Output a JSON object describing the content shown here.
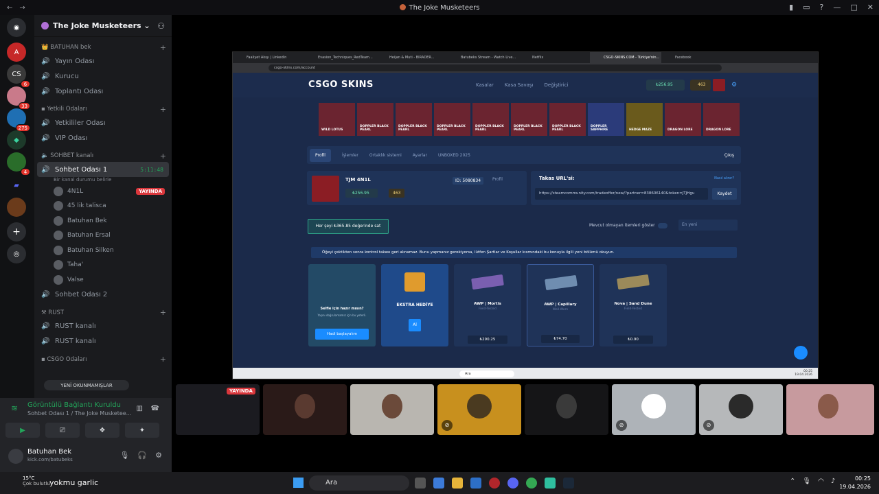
{
  "window": {
    "title": "The Joke Musketeers"
  },
  "servers": [
    {
      "name": "discord-home",
      "badge": ""
    },
    {
      "name": "server-a",
      "badge": ""
    },
    {
      "name": "server-csgo",
      "badge": "6"
    },
    {
      "name": "server-pink",
      "badge": "33"
    },
    {
      "name": "server-blue",
      "badge": "275"
    },
    {
      "name": "server-green",
      "badge": ""
    },
    {
      "name": "server-sprite",
      "badge": "4"
    },
    {
      "name": "server-folder",
      "badge": ""
    },
    {
      "name": "server-current",
      "badge": ""
    }
  ],
  "guild": {
    "name": "The Joke Musketeers"
  },
  "categories": {
    "c1": "BATUHAN bek",
    "c2": "Yetkili Odaları",
    "c3": "SOHBET kanalı",
    "c4": "RUST",
    "c5": "CSGO Odaları"
  },
  "channels": {
    "yayin": "Yayın Odası",
    "kurucu": "Kurucu",
    "toplanti": "Toplantı Odası",
    "yetkililer": "Yetkililer Odası",
    "vip": "VIP Odası",
    "sohbet1": "Sohbet Odası 1",
    "sohbet1_time": "5:11:48",
    "sohbet1_sub": "Bir kanal durumu belirle",
    "sohbet2": "Sohbet Odası 2",
    "rust1": "RUST kanalı",
    "rust2": "RUST kanalı"
  },
  "voice_users": [
    {
      "name": "4N1L",
      "live": "YAYINDA"
    },
    {
      "name": "45 lik talisca",
      "live": ""
    },
    {
      "name": "Batuhan Bek",
      "live": ""
    },
    {
      "name": "Batuhan Ersal",
      "live": ""
    },
    {
      "name": "Batuhan Silken",
      "live": ""
    },
    {
      "name": "Taha'",
      "live": ""
    },
    {
      "name": "Valse",
      "live": ""
    }
  ],
  "unread_pill": "YENİ OKUNMAMIŞLAR",
  "voice_panel": {
    "title": "Görüntülü Bağlantı Kuruldu",
    "subtitle": "Sohbet Odası 1 / The Joke Musketee..."
  },
  "user_panel": {
    "name": "Batuhan Bek",
    "status": "kick.com/batubeks"
  },
  "browser": {
    "tabs": [
      {
        "label": "Faaliyet Akışı | LinkedIn"
      },
      {
        "label": "Evasion_Techniques_RedTeam..."
      },
      {
        "label": "Heijan & Muti - BIRADER..."
      },
      {
        "label": "Batubeks Stream - Watch Live..."
      },
      {
        "label": "Netflix"
      },
      {
        "label": "CSGO-SKINS.COM - Türkiye'nin..."
      },
      {
        "label": "Facebook"
      }
    ],
    "url": "csgo-skins.com/account"
  },
  "site": {
    "logo": "CSGO SKINS",
    "nav": [
      "Kasalar",
      "Kasa Savaşı",
      "Değiştirici"
    ],
    "balance": "₺256.95",
    "coins": "463",
    "drops": [
      {
        "name": "WILD LOTUS"
      },
      {
        "name": "DOPPLER BLACK PEARL"
      },
      {
        "name": "DOPPLER BLACK PEARL"
      },
      {
        "name": "DOPPLER BLACK PEARL"
      },
      {
        "name": "DOPPLER BLACK PEARL"
      },
      {
        "name": "DOPPLER BLACK PEARL"
      },
      {
        "name": "DOPPLER BLACK PEARL"
      },
      {
        "name": "DOPPLER SAPPHIRE"
      },
      {
        "name": "HEDGE MAZE"
      },
      {
        "name": "DRAGON LORE"
      },
      {
        "name": "DRAGON LORE"
      }
    ],
    "tabs": [
      "Profil",
      "İşlemler",
      "Ortaklık sistemi",
      "Ayarlar",
      "UNBOXED 2025"
    ],
    "logout": "Çıkış",
    "profile": {
      "name": "TJM 4N1L",
      "id": "ID: 5080834",
      "profile_btn": "Profil",
      "balance": "₺256.95",
      "coins": "463"
    },
    "trade": {
      "label": "Takas URL'si:",
      "help": "Nasıl alınır?",
      "url": "https://steamcommunity.com/tradeoffer/new/?partner=838606140&token=JTJHgu",
      "save": "Kaydet"
    },
    "sell_all": "Her şeyi ₺365.85 değerinde sat",
    "filter_label": "Mevcut olmayan itemleri göster",
    "sort": "En yeni",
    "info": "Öğeyi çektikten sonra kontrol takası geri alınamaz. Bunu yapmanız gerekiyorsa, lütfen Şartlar ve Koşullar kısmındaki bu konuyla ilgili yeni bölümü okuyun.",
    "featured": {
      "title": "Selfie için hazır mısın?",
      "desc": "Yaşını doğrulamamız için bu yeterli.",
      "button": "Hadi başlayalım"
    },
    "gift": {
      "title": "EKSTRA HEDİYE",
      "button": "Al"
    },
    "items": [
      {
        "name": "AWP | Mortis",
        "wear": "Field-Tested",
        "price": "₺290.25"
      },
      {
        "name": "AWP | Capillary",
        "wear": "Well-Worn",
        "price": "₺74.70"
      },
      {
        "name": "Nova | Sand Dune",
        "wear": "Field-Tested",
        "price": "₺0.90"
      }
    ]
  },
  "win_taskbar_inner": {
    "search": "Ara",
    "time": "00:25",
    "date": "19.04.2026"
  },
  "tiles": [
    {
      "name": "stream-tile",
      "live": "YAYINDA"
    },
    {
      "name": "cam-1"
    },
    {
      "name": "cam-2"
    },
    {
      "name": "cam-3"
    },
    {
      "name": "cam-4"
    },
    {
      "name": "cam-5"
    },
    {
      "name": "cam-6"
    },
    {
      "name": "cam-7"
    }
  ],
  "taskbar": {
    "temp": "15°C",
    "condition": "Çok bulutlu",
    "text": "yokmu garlic",
    "search": "Ara",
    "time": "00:25",
    "date": "19.04.2026"
  }
}
